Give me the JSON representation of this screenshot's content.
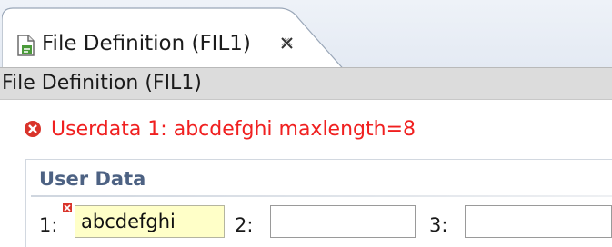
{
  "tab": {
    "label": "File Definition (FIL1)",
    "icon": "file-definition-icon",
    "close_icon": "close-icon"
  },
  "header": {
    "title": "File Definition (FIL1)"
  },
  "error": {
    "icon": "error-icon",
    "message": "Userdata 1: abcdefghi maxlength=8",
    "color": "#f02020"
  },
  "section": {
    "title": "User Data",
    "fields": [
      {
        "label": "1:",
        "value": "abcdefghi",
        "invalid": true
      },
      {
        "label": "2:",
        "value": ""
      },
      {
        "label": "3:",
        "value": ""
      }
    ]
  }
}
